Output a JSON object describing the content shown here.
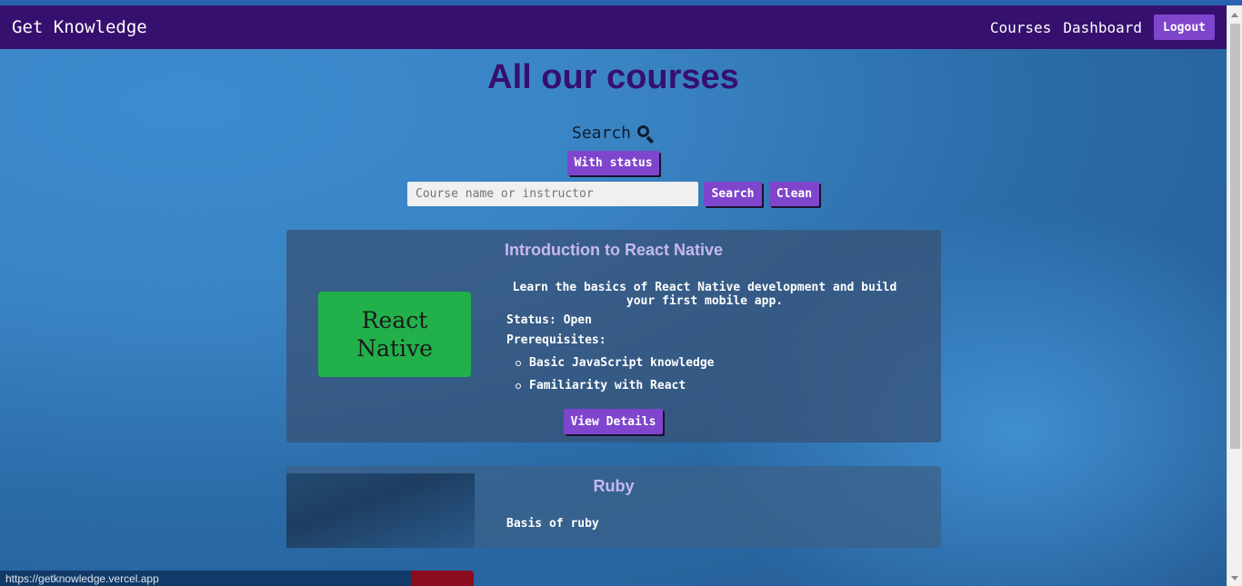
{
  "navbar": {
    "brand": "Get Knowledge",
    "links": [
      "Courses",
      "Dashboard"
    ],
    "logout_label": "Logout"
  },
  "main": {
    "title": "All our courses",
    "search_label": "Search",
    "status_button": "With status",
    "search_placeholder": "Course name or instructor",
    "search_button": "Search",
    "clean_button": "Clean"
  },
  "courses": [
    {
      "title": "Introduction to React Native",
      "image_text": [
        "React",
        "Native"
      ],
      "description": "Learn the basics of React Native development and build your first mobile app.",
      "status": "Status: Open",
      "prerequisites_label": "Prerequisites:",
      "prerequisites": [
        "Basic JavaScript knowledge",
        "Familiarity with React"
      ],
      "details_button": "View Details"
    },
    {
      "title": "Ruby",
      "description": "Basis of ruby"
    }
  ],
  "status_bar": {
    "url": "https://getknowledge.vercel.app"
  },
  "colors": {
    "navbar": "#36106e",
    "button": "#7f45cc",
    "title": "#36106e",
    "react_native_logo": "#22b04a"
  }
}
